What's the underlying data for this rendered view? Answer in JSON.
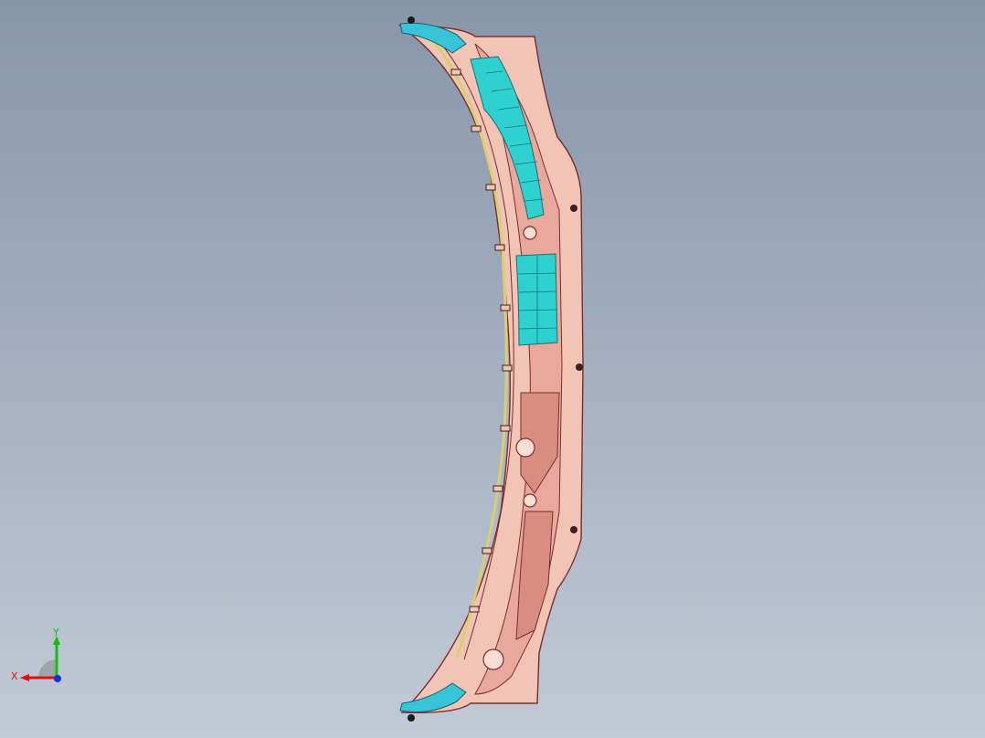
{
  "viewport": {
    "background_top": "#8896aa",
    "background_bottom": "#c2cad6"
  },
  "model": {
    "icon": "cowl-vent-panel-part",
    "colors": {
      "body": "#f2c4b6",
      "body_dark": "#d98c80",
      "edge": "#7a2e2e",
      "vent": "#2fd0d0",
      "end_cap": "#37c4d6",
      "rim": "#d8d070"
    }
  },
  "triad": {
    "x_label": "X",
    "y_label": "Y",
    "x_color": "#e01010",
    "y_color": "#10c010",
    "z_color": "#1030e0"
  }
}
